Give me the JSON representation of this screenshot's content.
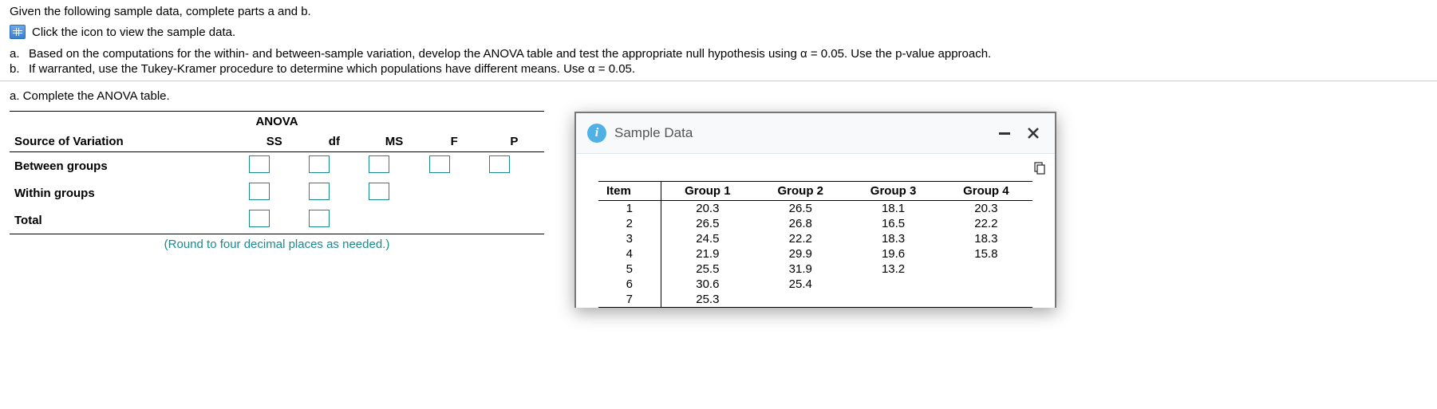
{
  "prompt": "Given the following sample data, complete parts a and b.",
  "icon_line": "Click the icon to view the sample data.",
  "parts": {
    "a_label": "a.",
    "a_text": "Based on the computations for the within- and between-sample variation, develop the ANOVA table and test the appropriate null hypothesis using α = 0.05. Use the p-value approach.",
    "b_label": "b.",
    "b_text": "If warranted, use the Tukey-Kramer procedure to determine which populations have different means. Use α = 0.05."
  },
  "section_a_prompt": "a. Complete the ANOVA table.",
  "anova": {
    "title": "ANOVA",
    "cols": [
      "Source of Variation",
      "SS",
      "df",
      "MS",
      "F",
      "P"
    ],
    "rows": [
      "Between groups",
      "Within groups",
      "Total"
    ]
  },
  "round_note": "(Round to four decimal places as needed.)",
  "popup": {
    "title": "Sample Data",
    "info_glyph": "i"
  },
  "sample_table": {
    "headers": [
      "Item",
      "Group 1",
      "Group 2",
      "Group 3",
      "Group 4"
    ],
    "rows": [
      {
        "item": "1",
        "g1": "20.3",
        "g2": "26.5",
        "g3": "18.1",
        "g4": "20.3"
      },
      {
        "item": "2",
        "g1": "26.5",
        "g2": "26.8",
        "g3": "16.5",
        "g4": "22.2"
      },
      {
        "item": "3",
        "g1": "24.5",
        "g2": "22.2",
        "g3": "18.3",
        "g4": "18.3"
      },
      {
        "item": "4",
        "g1": "21.9",
        "g2": "29.9",
        "g3": "19.6",
        "g4": "15.8"
      },
      {
        "item": "5",
        "g1": "25.5",
        "g2": "31.9",
        "g3": "13.2",
        "g4": ""
      },
      {
        "item": "6",
        "g1": "30.6",
        "g2": "25.4",
        "g3": "",
        "g4": ""
      },
      {
        "item": "7",
        "g1": "25.3",
        "g2": "",
        "g3": "",
        "g4": ""
      }
    ]
  },
  "chart_data": {
    "type": "table",
    "title": "Sample Data",
    "columns": [
      "Item",
      "Group 1",
      "Group 2",
      "Group 3",
      "Group 4"
    ],
    "data": [
      [
        1,
        20.3,
        26.5,
        18.1,
        20.3
      ],
      [
        2,
        26.5,
        26.8,
        16.5,
        22.2
      ],
      [
        3,
        24.5,
        22.2,
        18.3,
        18.3
      ],
      [
        4,
        21.9,
        29.9,
        19.6,
        15.8
      ],
      [
        5,
        25.5,
        31.9,
        13.2,
        null
      ],
      [
        6,
        30.6,
        25.4,
        null,
        null
      ],
      [
        7,
        25.3,
        null,
        null,
        null
      ]
    ]
  }
}
